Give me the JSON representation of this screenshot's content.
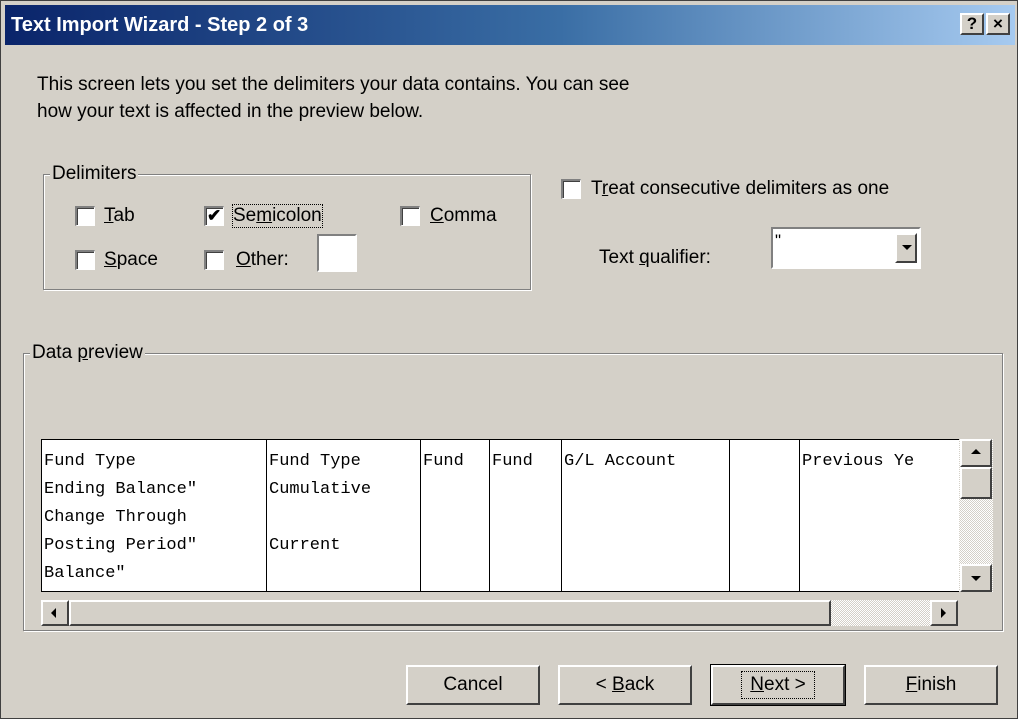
{
  "window": {
    "title": "Text Import Wizard - Step 2 of 3",
    "help_label": "?",
    "close_label": "×"
  },
  "intro": {
    "line1": "This screen lets you set the delimiters your data contains.  You can see",
    "line2": "how your text is affected in the preview below."
  },
  "delimiters": {
    "group_label": "Delimiters",
    "tab": {
      "label_u": "T",
      "label_rest": "ab",
      "checked": false
    },
    "semicolon": {
      "label_pre": "Se",
      "label_u": "m",
      "label_rest": "icolon",
      "checked": true
    },
    "comma": {
      "label_u": "C",
      "label_rest": "omma",
      "checked": false
    },
    "space": {
      "label_u": "S",
      "label_rest": "pace",
      "checked": false
    },
    "other": {
      "label_u": "O",
      "label_rest": "ther:",
      "checked": false,
      "value": ""
    }
  },
  "consecutive": {
    "label_pre": "T",
    "label_u": "r",
    "label_rest": "eat consecutive delimiters as one",
    "checked": false
  },
  "qualifier": {
    "label_pre": "Text ",
    "label_u": "q",
    "label_rest": "ualifier:",
    "value": "\""
  },
  "preview": {
    "group_label_pre": "Data ",
    "group_label_u": "p",
    "group_label_rest": "review",
    "columns": [
      {
        "lines": [
          "Fund Type",
          "Ending Balance\"",
          "Change Through",
          "Posting Period\"",
          "Balance\""
        ]
      },
      {
        "lines": [
          "Fund Type",
          "Cumulative",
          "",
          "Current",
          ""
        ]
      },
      {
        "lines": [
          "Fund"
        ]
      },
      {
        "lines": [
          "Fund"
        ]
      },
      {
        "lines": [
          "G/L Account"
        ]
      },
      {
        "lines": [
          ""
        ]
      },
      {
        "lines": [
          "Previous Ye"
        ]
      }
    ]
  },
  "buttons": {
    "cancel": "Cancel",
    "back_pre": "< ",
    "back_u": "B",
    "back_rest": "ack",
    "next_u": "N",
    "next_rest": "ext >",
    "finish_u": "F",
    "finish_rest": "inish"
  },
  "checkmark": "✔"
}
